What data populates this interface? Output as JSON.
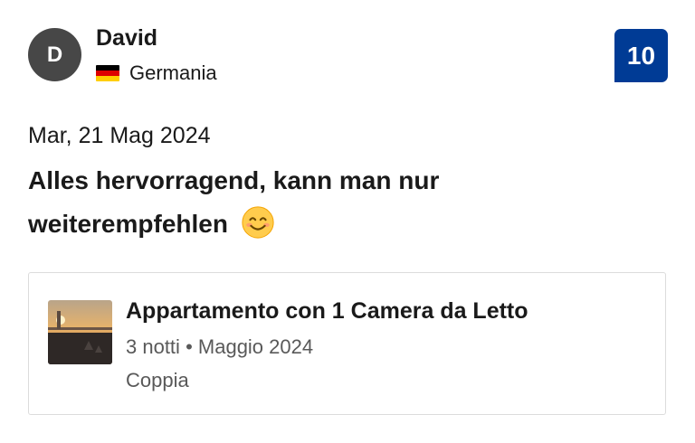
{
  "reviewer": {
    "initial": "D",
    "name": "David",
    "country": "Germania",
    "flag_colors": [
      "#000000",
      "#dd0000",
      "#ffce00"
    ]
  },
  "score": {
    "value": "10",
    "background": "#003b95"
  },
  "review": {
    "date": "Mar, 21 Mag 2024",
    "title": "Alles hervorragend, kann man nur weiterempfehlen",
    "emoji": "smiling-face-icon"
  },
  "stay": {
    "room_name": "Appartamento con 1 Camera da Letto",
    "nights": "3 notti",
    "separator": "•",
    "month": "Maggio 2024",
    "traveler_type": "Coppia",
    "thumbnail": "room-photo"
  }
}
